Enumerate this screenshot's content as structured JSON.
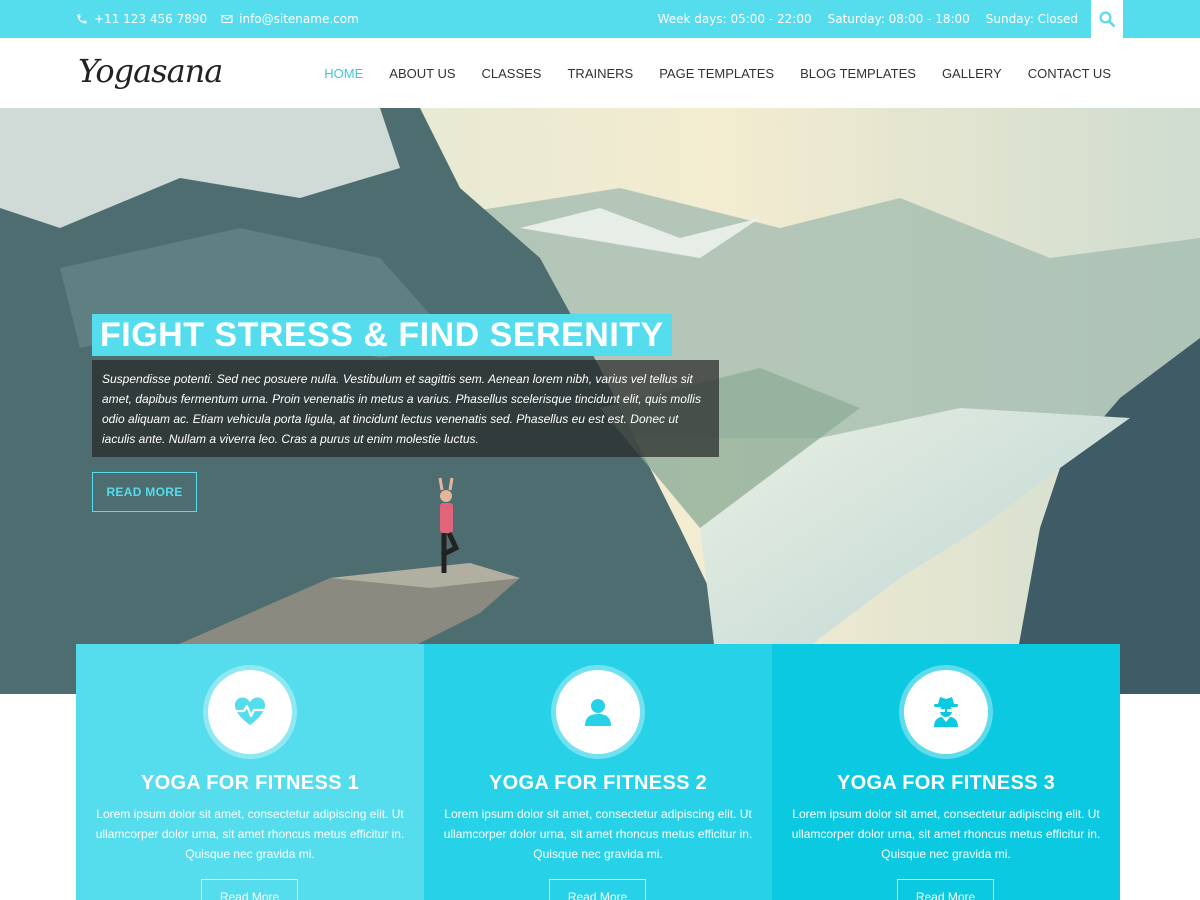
{
  "topbar": {
    "phone": "+11 123 456 7890",
    "email": "info@sitename.com",
    "hours": [
      "Week days: 05:00 - 22:00",
      "Saturday: 08:00 - 18:00",
      "Sunday: Closed"
    ]
  },
  "header": {
    "logo": "Yogasana",
    "nav": [
      "HOME",
      "ABOUT US",
      "CLASSES",
      "TRAINERS",
      "PAGE TEMPLATES",
      "BLOG TEMPLATES",
      "GALLERY",
      "CONTACT US"
    ]
  },
  "hero": {
    "title": "FIGHT STRESS & FIND SERENITY",
    "text": "Suspendisse potenti. Sed nec posuere nulla. Vestibulum et sagittis sem. Aenean lorem nibh, varius vel tellus sit amet, dapibus fermentum urna. Proin venenatis in metus a varius. Phasellus scelerisque tincidunt elit, quis mollis odio aliquam ac. Etiam vehicula porta ligula, at tincidunt lectus venenatis sed. Phasellus eu est est. Donec ut iaculis ante. Nullam a viverra leo. Cras a purus ut enim molestie luctus.",
    "button": "READ MORE"
  },
  "features": [
    {
      "icon": "heartbeat-icon",
      "title": "YOGA FOR FITNESS 1",
      "text": "Lorem ipsum dolor sit amet, consectetur adipiscing elit. Ut ullamcorper dolor urna, sit amet rhoncus metus efficitur in. Quisque nec gravida mi.",
      "button": "Read More",
      "color": "#55dced"
    },
    {
      "icon": "user-icon",
      "title": "YOGA FOR FITNESS 2",
      "text": "Lorem ipsum dolor sit amet, consectetur adipiscing elit. Ut ullamcorper dolor urna, sit amet rhoncus metus efficitur in. Quisque nec gravida mi.",
      "button": "Read More",
      "color": "#27d2e8"
    },
    {
      "icon": "user-secret-icon",
      "title": "YOGA FOR FITNESS 3",
      "text": "Lorem ipsum dolor sit amet, consectetur adipiscing elit. Ut ullamcorper dolor urna, sit amet rhoncus metus efficitur in. Quisque nec gravida mi.",
      "button": "Read More",
      "color": "#0ac9e0"
    }
  ],
  "colors": {
    "accent": "#55dced",
    "nav_active": "#3ec6d8",
    "text_dark": "#333333"
  }
}
